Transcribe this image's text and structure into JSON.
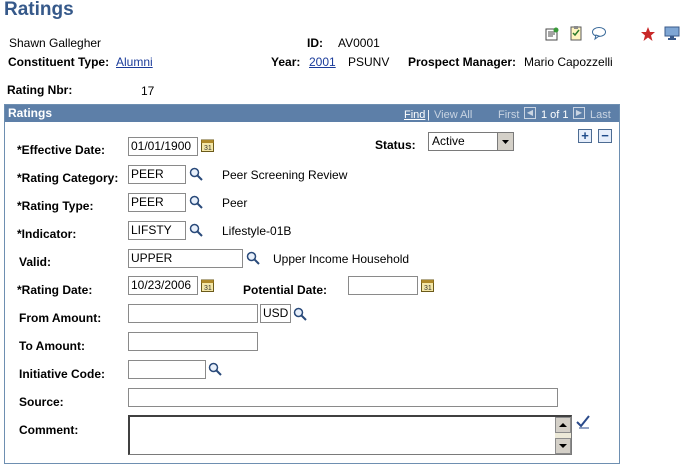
{
  "page": {
    "title": "Ratings"
  },
  "header": {
    "name": "Shawn Gallegher",
    "id_label": "ID:",
    "id_value": "AV0001",
    "constituent_type_label": "Constituent Type:",
    "constituent_type_value": "Alumni",
    "year_label": "Year:",
    "year_value": "2001",
    "year_code": "PSUNV",
    "prospect_manager_label": "Prospect Manager:",
    "prospect_manager_value": "Mario Capozzelli",
    "rating_nbr_label": "Rating Nbr:",
    "rating_nbr_value": "17"
  },
  "toolbar": {
    "icons": [
      "notes-icon",
      "checklist-icon",
      "comment-icon",
      "favorite-star-icon",
      "monitor-icon"
    ]
  },
  "panel": {
    "title": "Ratings",
    "find_label": "Find",
    "view_all_label": "View All",
    "first_label": "First",
    "page_indicator": "1 of 1",
    "last_label": "Last"
  },
  "form": {
    "effective_date_label": "*Effective Date:",
    "effective_date_value": "01/01/1900",
    "status_label": "Status:",
    "status_value": "Active",
    "rating_category_label": "*Rating Category:",
    "rating_category_value": "PEER",
    "rating_category_desc": "Peer Screening Review",
    "rating_type_label": "*Rating Type:",
    "rating_type_value": "PEER",
    "rating_type_desc": "Peer",
    "indicator_label": "*Indicator:",
    "indicator_value": "LIFSTY",
    "indicator_desc": "Lifestyle-01B",
    "valid_label": "Valid:",
    "valid_value": "UPPER",
    "valid_desc": "Upper Income Household",
    "rating_date_label": "*Rating Date:",
    "rating_date_value": "10/23/2006",
    "potential_date_label": "Potential Date:",
    "potential_date_value": "",
    "from_amount_label": "From Amount:",
    "from_amount_value": "",
    "currency_value": "USD",
    "to_amount_label": "To Amount:",
    "to_amount_value": "",
    "initiative_code_label": "Initiative Code:",
    "initiative_code_value": "",
    "source_label": "Source:",
    "source_value": "",
    "comment_label": "Comment:",
    "comment_value": ""
  },
  "colors": {
    "title": "#36598a",
    "panel_header": "#5d7fa8",
    "link": "#1a3b9a"
  }
}
